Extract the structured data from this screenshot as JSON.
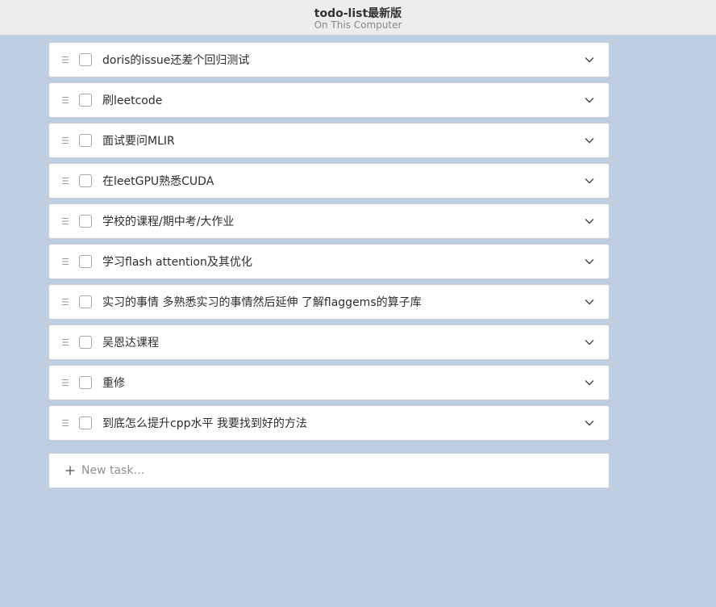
{
  "window": {
    "title": "todo-list最新版",
    "subtitle": "On This Computer"
  },
  "tasks": [
    {
      "label": "doris的issue还差个回归测试",
      "done": false
    },
    {
      "label": "刷leetcode",
      "done": false
    },
    {
      "label": "面试要问MLIR",
      "done": false
    },
    {
      "label": "在leetGPU熟悉CUDA",
      "done": false
    },
    {
      "label": "学校的课程/期中考/大作业",
      "done": false
    },
    {
      "label": "学习flash attention及其优化",
      "done": false
    },
    {
      "label": "实习的事情 多熟悉实习的事情然后延伸 了解flaggems的算子库",
      "done": false
    },
    {
      "label": "吴恩达课程",
      "done": false
    },
    {
      "label": "重修",
      "done": false
    },
    {
      "label": "到底怎么提升cpp水平 我要找到好的方法",
      "done": false
    }
  ],
  "new_task": {
    "placeholder": "New task…",
    "value": ""
  },
  "icons": {
    "drag": "drag-handle-icon",
    "expand": "chevron-down-icon",
    "add": "plus-icon"
  },
  "colors": {
    "background": "#bfcde0",
    "titlebar": "#edecee",
    "card": "#ffffff"
  }
}
